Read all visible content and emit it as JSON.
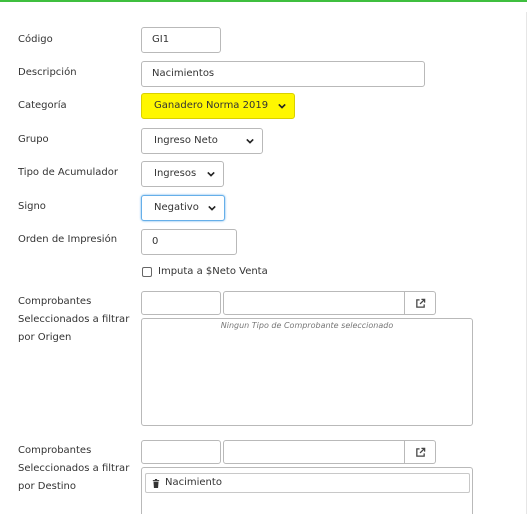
{
  "form": {
    "codigo": {
      "label": "Código",
      "value": "GI1"
    },
    "descripcion": {
      "label": "Descripción",
      "value": "Nacimientos"
    },
    "categoria": {
      "label": "Categoría",
      "selected": "Ganadero Norma 2019"
    },
    "grupo": {
      "label": "Grupo",
      "selected": "Ingreso Neto"
    },
    "tipo_acumulador": {
      "label": "Tipo de Acumulador",
      "selected": "Ingresos"
    },
    "signo": {
      "label": "Signo",
      "selected": "Negativo"
    },
    "orden_impresion": {
      "label": "Orden de Impresión",
      "value": "0"
    },
    "imputa": {
      "label": "Imputa a $Neto Venta",
      "checked": false
    },
    "origen": {
      "label_lines": [
        "Comprobantes",
        "Seleccionados a filtrar",
        "por Origen"
      ],
      "empty_message": "Ningun Tipo de Comprobante seleccionado"
    },
    "destino": {
      "label_lines": [
        "Comprobantes",
        "Seleccionados a filtrar",
        "por Destino"
      ],
      "items": [
        "Nacimiento"
      ]
    }
  },
  "colors": {
    "highlight": "#fff700",
    "top_border": "#3fbf3f"
  },
  "icons": {
    "external": "external-link-icon",
    "chevron": "chevron-down-icon",
    "trash": "trash-icon"
  }
}
